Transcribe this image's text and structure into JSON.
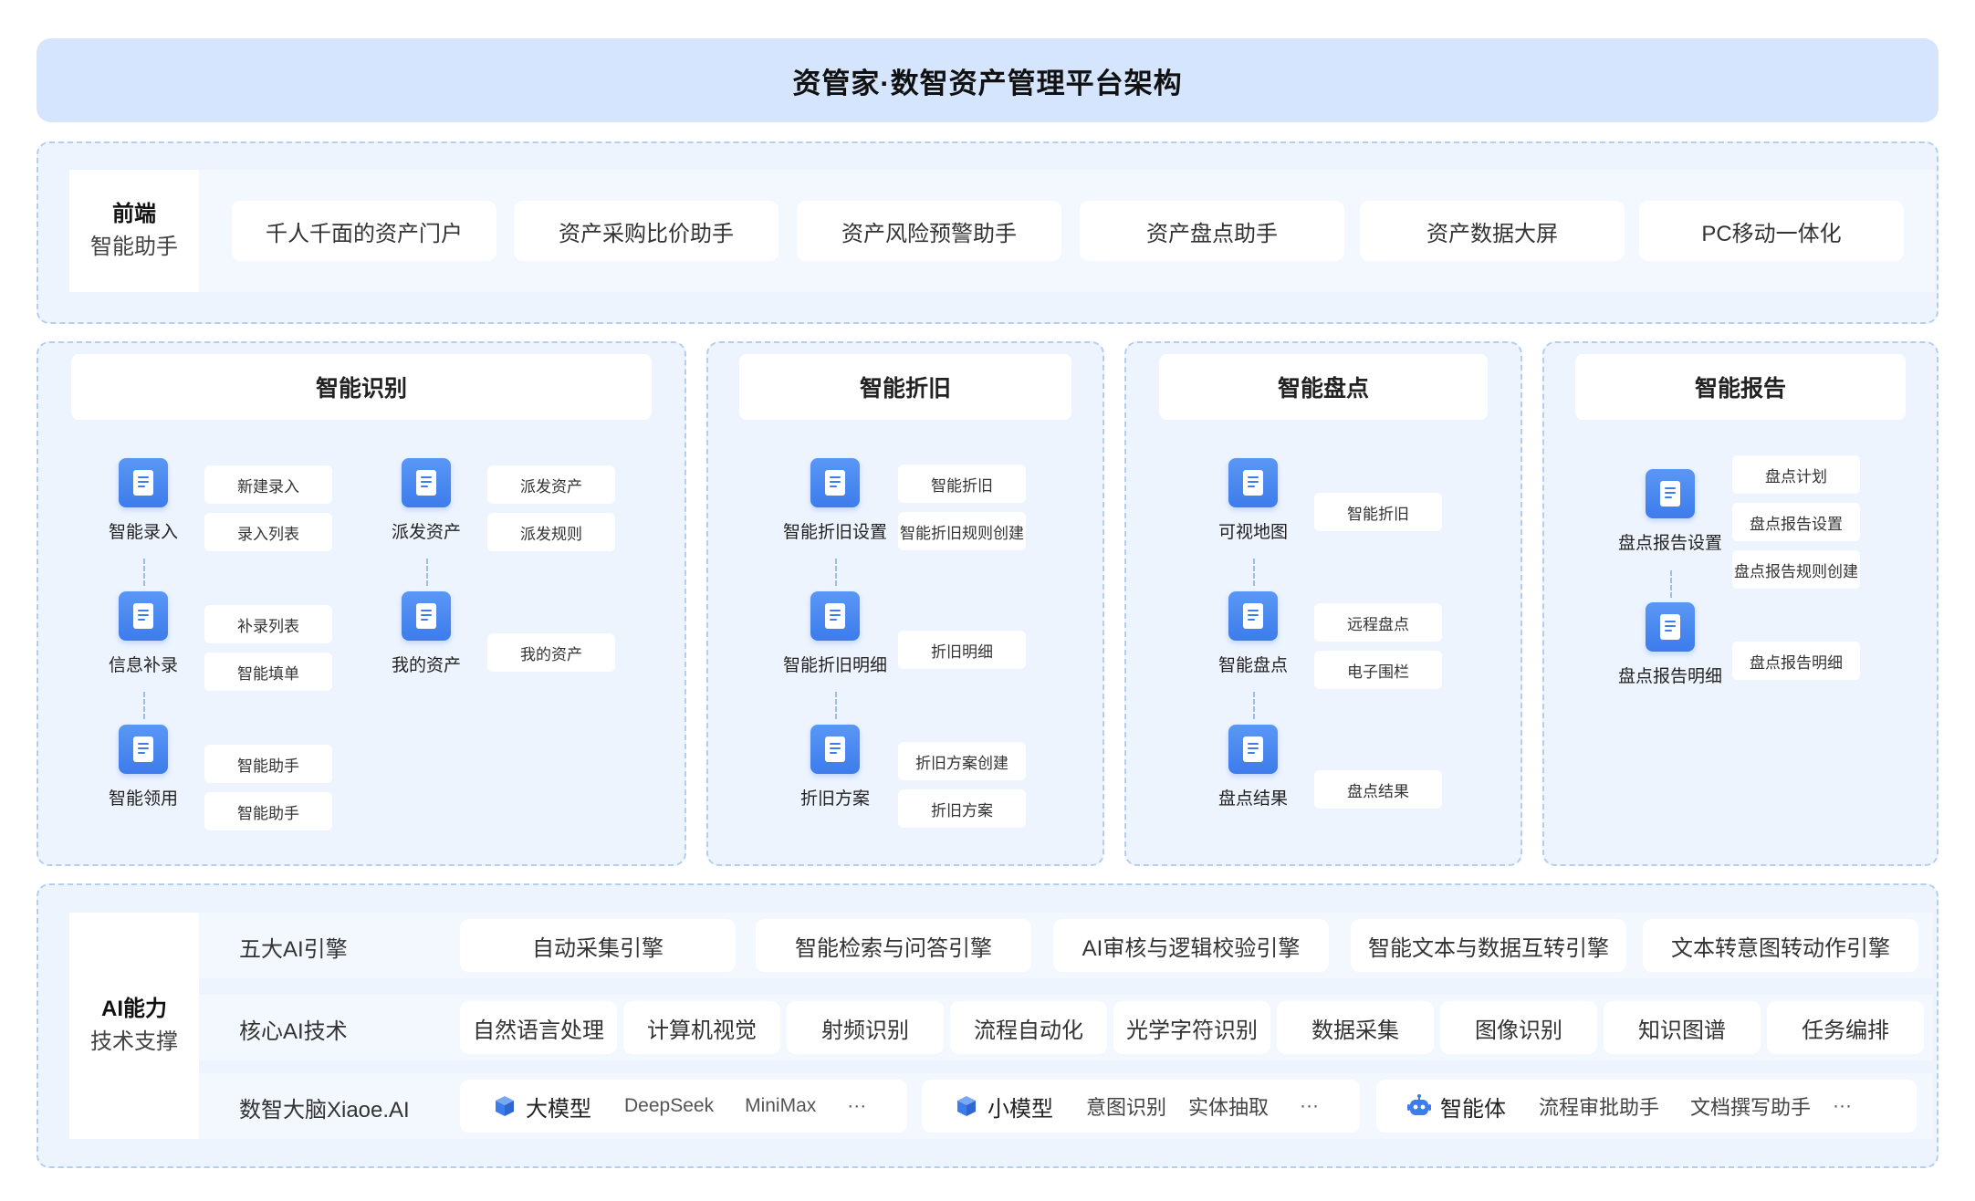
{
  "title": "资管家·数智资产管理平台架构",
  "frontend": {
    "label_line1": "前端",
    "label_line2": "智能助手",
    "items": [
      "千人千面的资产门户",
      "资产采购比价助手",
      "资产风险预警助手",
      "资产盘点助手",
      "资产数据大屏",
      "PC移动一体化"
    ]
  },
  "recognition": {
    "title": "智能识别",
    "nodes": [
      "智能录入",
      "信息补录",
      "智能领用",
      "派发资产",
      "我的资产"
    ],
    "tags": {
      "entry": [
        "新建录入",
        "录入列表"
      ],
      "supplement": [
        "补录列表",
        "智能填单"
      ],
      "claim": [
        "智能助手",
        "智能助手"
      ],
      "dispatch": [
        "派发资产",
        "派发规则"
      ],
      "mine": [
        "我的资产"
      ]
    }
  },
  "depreciation": {
    "title": "智能折旧",
    "nodes": [
      "智能折旧设置",
      "智能折旧明细",
      "折旧方案"
    ],
    "tags": {
      "settings": [
        "智能折旧",
        "智能折旧规则创建"
      ],
      "detail": [
        "折旧明细"
      ],
      "plan": [
        "折旧方案创建",
        "折旧方案"
      ]
    }
  },
  "inventory": {
    "title": "智能盘点",
    "nodes": [
      "可视地图",
      "智能盘点",
      "盘点结果"
    ],
    "tags": {
      "map": [
        "智能折旧"
      ],
      "count": [
        "远程盘点",
        "电子围栏"
      ],
      "result": [
        "盘点结果"
      ]
    }
  },
  "report": {
    "title": "智能报告",
    "nodes": [
      "盘点报告设置",
      "盘点报告明细"
    ],
    "tags": {
      "settings": [
        "盘点计划",
        "盘点报告设置",
        "盘点报告规则创建"
      ],
      "detail": [
        "盘点报告明细"
      ]
    }
  },
  "ai": {
    "label_line1": "AI能力",
    "label_line2": "技术支撑",
    "engines": {
      "label": "五大AI引擎",
      "items": [
        "自动采集引擎",
        "智能检索与问答引擎",
        "AI审核与逻辑校验引擎",
        "智能文本与数据互转引擎",
        "文本转意图转动作引擎"
      ]
    },
    "core": {
      "label": "核心AI技术",
      "items": [
        "自然语言处理",
        "计算机视觉",
        "射频识别",
        "流程自动化",
        "光学字符识别",
        "数据采集",
        "图像识别",
        "知识图谱",
        "任务编排"
      ]
    },
    "brain": {
      "label": "数智大脑Xiaoe.AI",
      "groups": [
        {
          "icon": "cube-icon",
          "name": "大模型",
          "items": [
            "DeepSeek",
            "MiniMax",
            "···"
          ]
        },
        {
          "icon": "cube-icon",
          "name": "小模型",
          "items": [
            "意图识别",
            "实体抽取",
            "···"
          ]
        },
        {
          "icon": "robot-icon",
          "name": "智能体",
          "items": [
            "流程审批助手",
            "文档撰写助手",
            "···"
          ]
        }
      ]
    }
  },
  "colors": {
    "title_bg": "#d4e5fd",
    "panel_bg": "#edf4fe",
    "accent": "#3d7ceb",
    "dashed_border": "#b5cdee"
  }
}
